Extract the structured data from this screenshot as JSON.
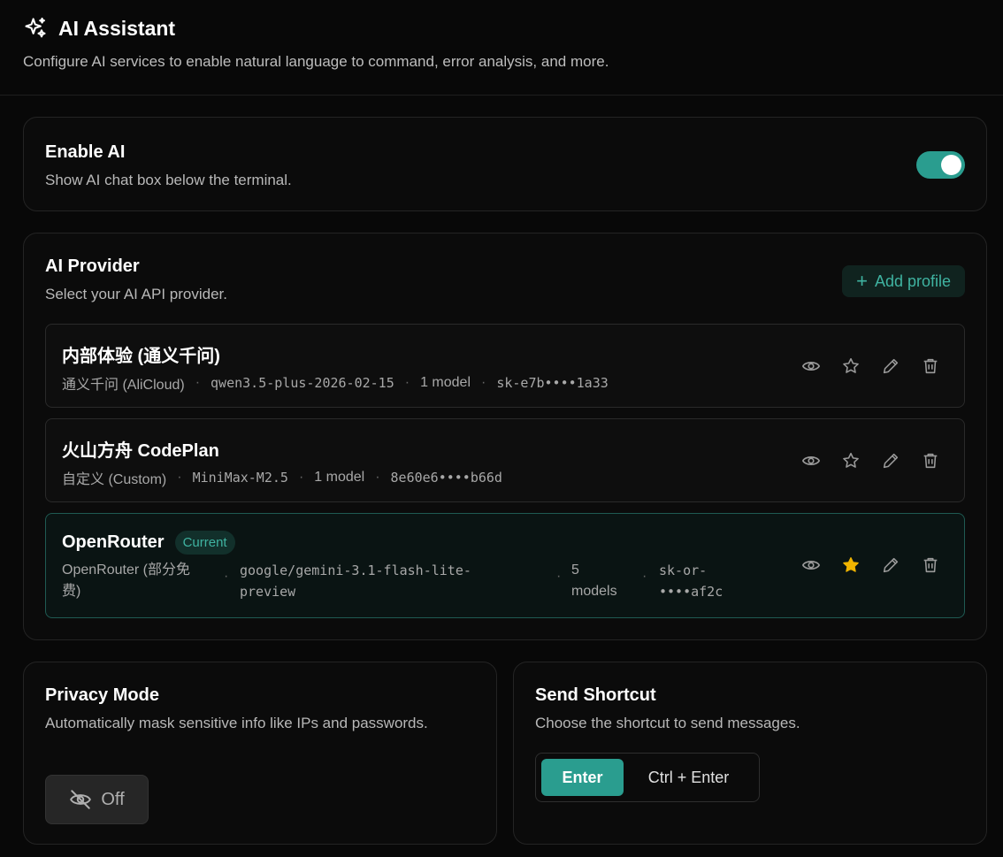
{
  "header": {
    "icon": "sparkles-icon",
    "title": "AI Assistant",
    "description": "Configure AI services to enable natural language to command, error analysis, and more."
  },
  "enable_ai": {
    "title": "Enable AI",
    "description": "Show AI chat box below the terminal.",
    "toggle_on": true,
    "accent": "#2a9d8f"
  },
  "provider": {
    "title": "AI Provider",
    "description": "Select your AI API provider.",
    "add_label": "Add profile",
    "profiles": [
      {
        "name": "内部体验 (通义千问)",
        "provider": "通义千问 (AliCloud)",
        "model": "qwen3.5-plus-2026-02-15",
        "model_count": "1 model",
        "key": "sk-e7b••••1a33",
        "current": false
      },
      {
        "name": "火山方舟 CodePlan",
        "provider": "自定义 (Custom)",
        "model": "MiniMax-M2.5",
        "model_count": "1 model",
        "key": "8e60e6••••b66d",
        "current": false
      },
      {
        "name": "OpenRouter",
        "badge": "Current",
        "provider_line1": "OpenRouter (部分免",
        "provider_line2": "费)",
        "model_line1": "google/gemini-3.1-flash-lite-",
        "model_line2": "preview",
        "count_line1": "5",
        "count_line2": "models",
        "key_line1": "sk-or-",
        "key_line2": "••••af2c",
        "current": true
      }
    ]
  },
  "privacy": {
    "title": "Privacy Mode",
    "description": "Automatically mask sensitive info like IPs and passwords.",
    "button_label": "Off"
  },
  "shortcut": {
    "title": "Send Shortcut",
    "description": "Choose the shortcut to send messages.",
    "options": [
      "Enter",
      "Ctrl + Enter"
    ],
    "selected": "Enter"
  }
}
